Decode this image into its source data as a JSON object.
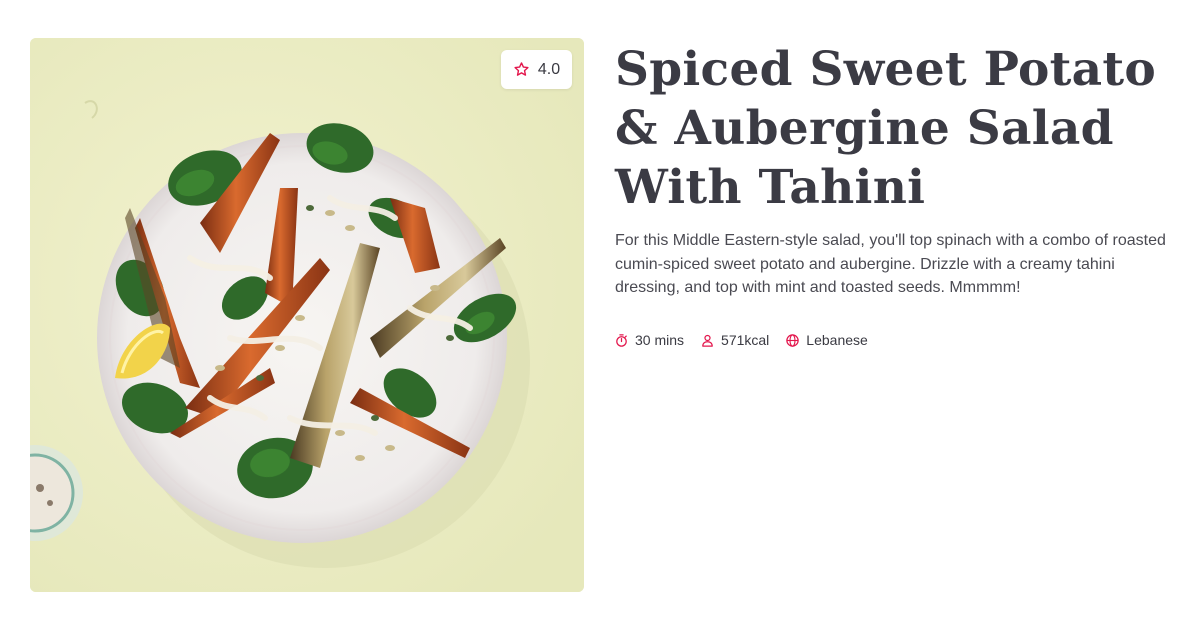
{
  "recipe": {
    "title": "Spiced Sweet Potato & Aubergine Salad With Tahini",
    "description": "For this Middle Eastern-style salad, you'll top spinach with a combo of roasted cumin-spiced sweet potato and aubergine. Drizzle with a creamy tahini dressing, and top with mint and toasted seeds. Mmmmm!",
    "rating": "4.0",
    "meta": {
      "time": "30 mins",
      "calories": "571kcal",
      "cuisine": "Lebanese"
    },
    "image_subject": "Salad of roasted sweet potato wedges, aubergine, spinach, tahini drizzle, seeds and lemon on a white plate"
  },
  "icons": {
    "rating": "star-outline-icon",
    "time": "stopwatch-icon",
    "calories": "person-icon",
    "cuisine": "globe-icon"
  },
  "colors": {
    "accent": "#e3174d",
    "text": "#3b3b44",
    "photo_background": "#ecedc4"
  }
}
